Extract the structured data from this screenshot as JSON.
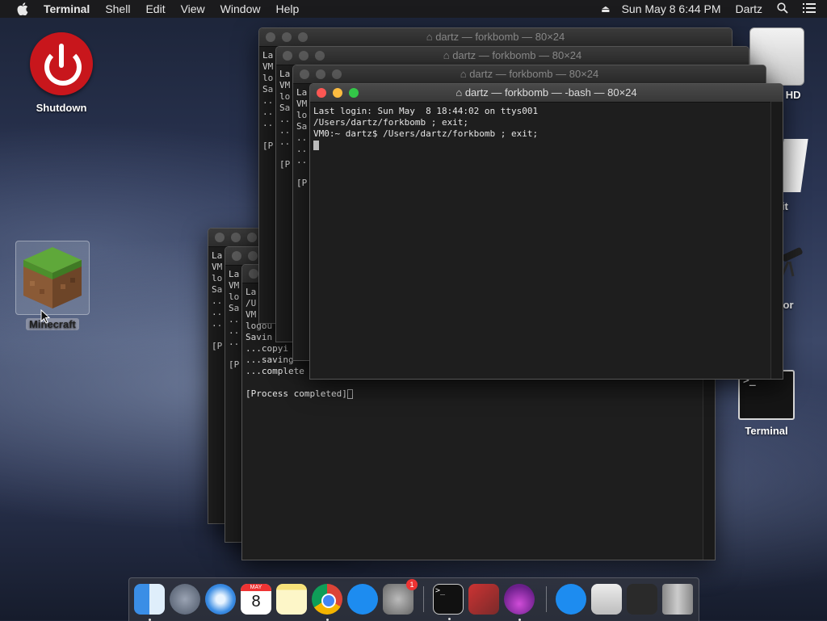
{
  "menubar": {
    "apple": "",
    "app": "Terminal",
    "items": [
      "Shell",
      "Edit",
      "View",
      "Window",
      "Help"
    ],
    "datetime": "Sun May 8  6:44 PM",
    "user": "Dartz"
  },
  "desktop": {
    "shutdown": "Shutdown",
    "minecraft": "Minecraft",
    "disk": "sh HD",
    "textedit": "dit",
    "calculator": "ator",
    "terminal": "Terminal",
    "terminal_prompt": ">_"
  },
  "windows": {
    "title_forkbomb": "dartz — forkbomb — 80×24",
    "title_active": "dartz — forkbomb — -bash — 80×24",
    "active_lines": [
      "Last login: Sun May  8 18:44:02 on ttys001",
      "/Users/dartz/forkbomb ; exit;",
      "VM0:~ dartz$ /Users/dartz/forkbomb ; exit;"
    ],
    "frag_a": "La\nVM\nlo\nSa\n..\n..\n..\n\n[P",
    "frag_b": "La\nVM\nlo\nSa\n..\n..\n..\n\n[P",
    "frag_c": "La\nVM\nlo\nSa\n..\n..\n..\n\n[P",
    "frag_d": "La\nVM\nlo\nSa\n..\n..\n..\n\n[P",
    "frag_e": "La\nVM\nlo\nSa\n..\n..\n..\n\n[P",
    "frag_f": "La\n/U\nVM\nlogou\nSavin\n...copyi\n...saving\n...complete",
    "process_completed": "[Process completed]"
  },
  "dock": {
    "calendar_month": "MAY",
    "calendar_day": "8",
    "badge": "1",
    "terminal_prompt": ">_"
  }
}
